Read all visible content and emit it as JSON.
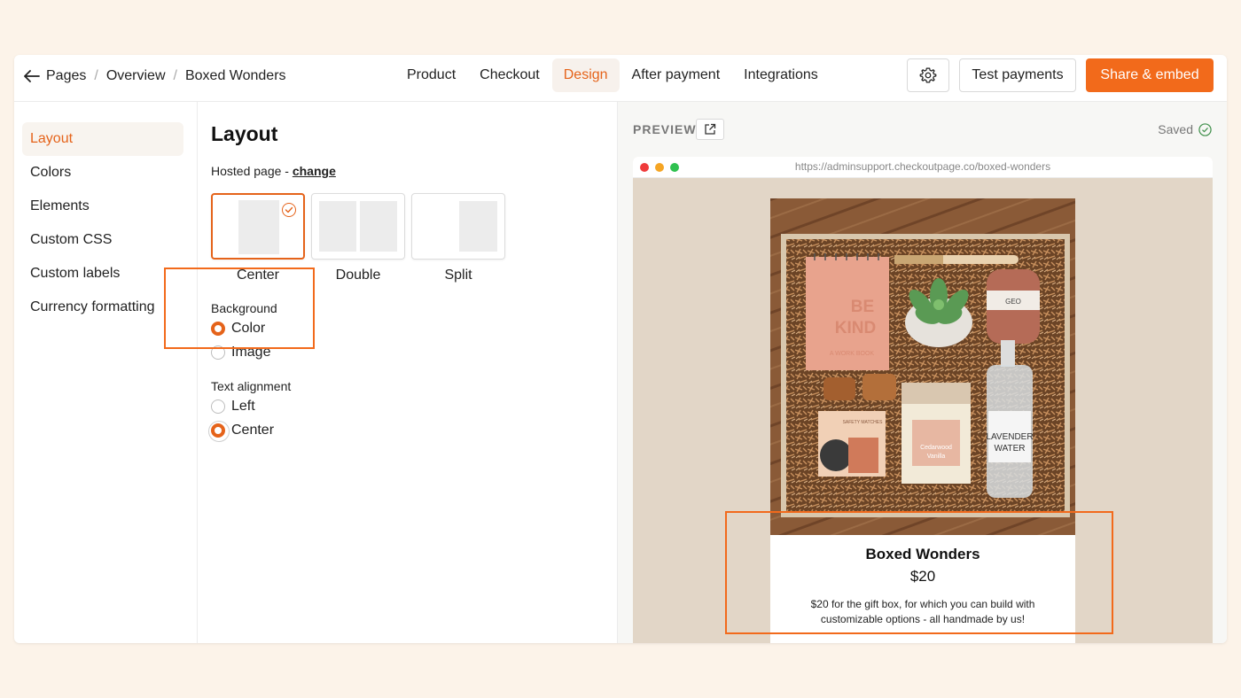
{
  "breadcrumb": {
    "items": [
      "Pages",
      "Overview",
      "Boxed Wonders"
    ]
  },
  "tabs": [
    "Product",
    "Checkout",
    "Design",
    "After payment",
    "Integrations"
  ],
  "active_tab": "Design",
  "header_buttons": {
    "test": "Test payments",
    "share": "Share & embed"
  },
  "sidebar": {
    "items": [
      "Layout",
      "Colors",
      "Elements",
      "Custom CSS",
      "Custom labels",
      "Currency formatting"
    ],
    "active": "Layout"
  },
  "settings": {
    "title": "Layout",
    "hosted_prefix": "Hosted page - ",
    "hosted_link": "change",
    "layouts": [
      "Center",
      "Double",
      "Split"
    ],
    "selected_layout": "Center",
    "background": {
      "label": "Background",
      "options": [
        "Color",
        "Image"
      ],
      "selected": "Color"
    },
    "text_alignment": {
      "label": "Text alignment",
      "options": [
        "Left",
        "Center"
      ],
      "selected": "Center"
    }
  },
  "preview": {
    "label": "PREVIEW",
    "saved": "Saved",
    "url": "https://adminsupport.checkoutpage.co/boxed-wonders",
    "product": {
      "title": "Boxed Wonders",
      "price": "$20",
      "description": "$20 for the gift box, for which you can build with customizable options - all handmade by us!",
      "photo_texts": {
        "notebook": "BE KIND",
        "notebook_sub": "A WORK BOOK",
        "bottle": "LAVENDER WATER",
        "candle": "Cedarwood Vanilla",
        "soap": "GEO",
        "matches": "SAFETY MATCHES"
      }
    }
  },
  "colors": {
    "accent": "#e5631a",
    "button": "#f26a1b",
    "page_bg": "#fcf3e9"
  }
}
